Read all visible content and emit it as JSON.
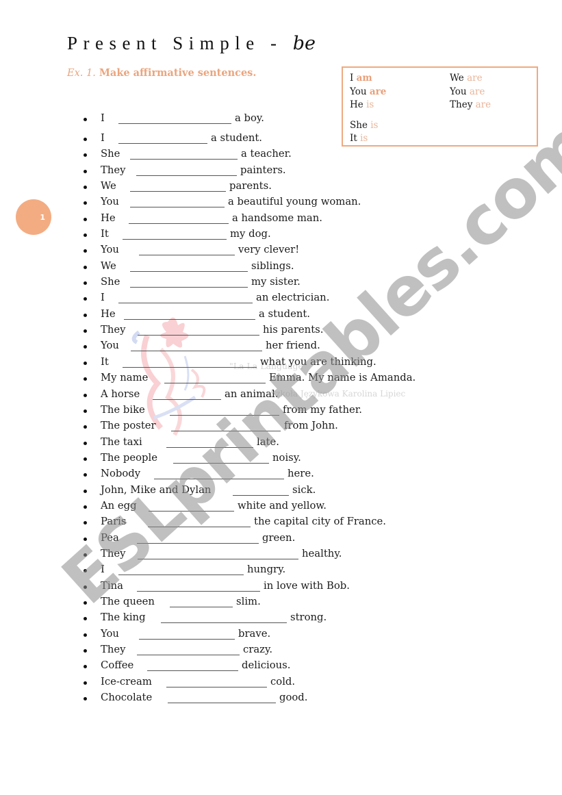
{
  "header": {
    "title_main": "Present Simple - ",
    "title_italic": "be",
    "instruction_ex": "Ex. 1.",
    "instruction_text": " Make affirmative sentences."
  },
  "conjugation_box": {
    "left": [
      {
        "pronoun": "I ",
        "verb": "am",
        "style": "strong"
      },
      {
        "pronoun": "You ",
        "verb": "are",
        "style": "strong"
      },
      {
        "pronoun": "He ",
        "verb": "is",
        "style": "light"
      },
      {
        "pronoun": "She ",
        "verb": "is",
        "style": "light"
      },
      {
        "pronoun": "It ",
        "verb": "is",
        "style": "light"
      }
    ],
    "right": [
      {
        "pronoun": "We ",
        "verb": "are",
        "style": "light"
      },
      {
        "pronoun": "You ",
        "verb": "are",
        "style": "light"
      },
      {
        "pronoun": "They ",
        "verb": "are",
        "style": "light"
      }
    ]
  },
  "page_badge": "1",
  "exercise_items": [
    {
      "subject": "I",
      "rest": "a boy."
    },
    {
      "subject": "I",
      "rest": "a student."
    },
    {
      "subject": "She",
      "rest": "a teacher."
    },
    {
      "subject": "They",
      "rest": "painters."
    },
    {
      "subject": "We",
      "rest": "parents."
    },
    {
      "subject": "You",
      "rest": "a beautiful young woman."
    },
    {
      "subject": "He",
      "rest": "a handsome man."
    },
    {
      "subject": "It",
      "rest": "my dog."
    },
    {
      "subject": "You",
      "rest": "very clever!"
    },
    {
      "subject": "We",
      "rest": "siblings."
    },
    {
      "subject": "She",
      "rest": "my sister."
    },
    {
      "subject": "I",
      "rest": "an electrician."
    },
    {
      "subject": "He",
      "rest": "a student."
    },
    {
      "subject": "They",
      "rest": "his parents."
    },
    {
      "subject": "You",
      "rest": "her friend."
    },
    {
      "subject": "It",
      "rest": "what you are thinking."
    },
    {
      "subject": "My name",
      "rest": "Emma. My name is Amanda."
    },
    {
      "subject": "A horse",
      "rest": "an animal."
    },
    {
      "subject": "The bike",
      "rest": "from my father."
    },
    {
      "subject": "The poster",
      "rest": "from John."
    },
    {
      "subject": "The taxi",
      "rest": "late."
    },
    {
      "subject": "The people",
      "rest": "noisy."
    },
    {
      "subject": "Nobody",
      "rest": "here."
    },
    {
      "subject": "John, Mike and Dylan",
      "rest": "sick."
    },
    {
      "subject": "An egg",
      "rest": "white and yellow."
    },
    {
      "subject": "Paris",
      "rest": "the capital city of France."
    },
    {
      "subject": "Pea",
      "rest": "green."
    },
    {
      "subject": "They",
      "rest": "healthy."
    },
    {
      "subject": "I",
      "rest": "hungry."
    },
    {
      "subject": "Tina",
      "rest": "in love with Bob."
    },
    {
      "subject": "The queen",
      "rest": "slim."
    },
    {
      "subject": "The king",
      "rest": "strong."
    },
    {
      "subject": "You",
      "rest": "brave."
    },
    {
      "subject": "They",
      "rest": "crazy."
    },
    {
      "subject": "Coffee",
      "rest": "delicious."
    },
    {
      "subject": "Ice-cream",
      "rest": "cold."
    },
    {
      "subject": "Chocolate",
      "rest": "good."
    }
  ],
  "watermark": {
    "text": "ESLprintables.com",
    "school_name": "\"La La Language\"",
    "school_sub": "Szkoła Językowa Karolina Lipiec"
  },
  "colors": {
    "accent": "#eaa57e",
    "badge": "#f3ac82",
    "box_border": "#efa980"
  }
}
